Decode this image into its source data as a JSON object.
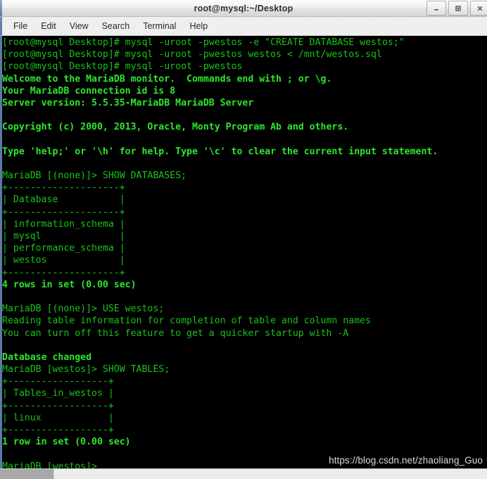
{
  "window": {
    "title": "root@mysql:~/Desktop",
    "controls": [
      {
        "name": "minimize",
        "label": "–"
      },
      {
        "name": "maximize",
        "label": "□"
      },
      {
        "name": "close",
        "label": "✕"
      }
    ]
  },
  "menubar": {
    "items": [
      "File",
      "Edit",
      "View",
      "Search",
      "Terminal",
      "Help"
    ]
  },
  "terminal": {
    "lines": [
      {
        "text": "[root@mysql Desktop]# mysql -uroot -pwestos -e \"CREATE DATABASE westos;\"",
        "style": "normal"
      },
      {
        "text": "[root@mysql Desktop]# mysql -uroot -pwestos westos < /mnt/westos.sql",
        "style": "normal"
      },
      {
        "text": "[root@mysql Desktop]# mysql -uroot -pwestos",
        "style": "normal"
      },
      {
        "text": "Welcome to the MariaDB monitor.  Commands end with ; or \\g.",
        "style": "bold"
      },
      {
        "text": "Your MariaDB connection id is 8",
        "style": "bold"
      },
      {
        "text": "Server version: 5.5.35-MariaDB MariaDB Server",
        "style": "bold"
      },
      {
        "text": "",
        "style": "blank"
      },
      {
        "text": "Copyright (c) 2000, 2013, Oracle, Monty Program Ab and others.",
        "style": "bold"
      },
      {
        "text": "",
        "style": "blank"
      },
      {
        "text": "Type 'help;' or '\\h' for help. Type '\\c' to clear the current input statement.",
        "style": "bold"
      },
      {
        "text": "",
        "style": "blank"
      },
      {
        "text": "MariaDB [(none)]> SHOW DATABASES;",
        "style": "normal"
      },
      {
        "text": "+--------------------+",
        "style": "normal"
      },
      {
        "text": "| Database           |",
        "style": "normal"
      },
      {
        "text": "+--------------------+",
        "style": "normal"
      },
      {
        "text": "| information_schema |",
        "style": "normal"
      },
      {
        "text": "| mysql              |",
        "style": "normal"
      },
      {
        "text": "| performance_schema |",
        "style": "normal"
      },
      {
        "text": "| westos             |",
        "style": "normal"
      },
      {
        "text": "+--------------------+",
        "style": "normal"
      },
      {
        "text": "4 rows in set (0.00 sec)",
        "style": "bold"
      },
      {
        "text": "",
        "style": "blank"
      },
      {
        "text": "MariaDB [(none)]> USE westos;",
        "style": "normal"
      },
      {
        "text": "Reading table information for completion of table and column names",
        "style": "normal"
      },
      {
        "text": "You can turn off this feature to get a quicker startup with -A",
        "style": "normal"
      },
      {
        "text": "",
        "style": "blank"
      },
      {
        "text": "Database changed",
        "style": "bold"
      },
      {
        "text": "MariaDB [westos]> SHOW TABLES;",
        "style": "normal"
      },
      {
        "text": "+------------------+",
        "style": "normal"
      },
      {
        "text": "| Tables_in_westos |",
        "style": "normal"
      },
      {
        "text": "+------------------+",
        "style": "normal"
      },
      {
        "text": "| linux            |",
        "style": "normal"
      },
      {
        "text": "+------------------+",
        "style": "normal"
      },
      {
        "text": "1 row in set (0.00 sec)",
        "style": "bold"
      },
      {
        "text": "",
        "style": "blank"
      },
      {
        "text": "MariaDB [westos]>",
        "style": "normal"
      }
    ],
    "watermark": "https://blog.csdn.net/zhaoliang_Guo"
  },
  "taskbar": {
    "buttons": [
      {
        "label": ""
      }
    ]
  },
  "colors": {
    "terminal_bg": "#000000",
    "text_green": "#1ac21a",
    "text_green_bold": "#2ee62e",
    "titlebar": "#ededed",
    "accent_edge": "#5d79a8"
  }
}
